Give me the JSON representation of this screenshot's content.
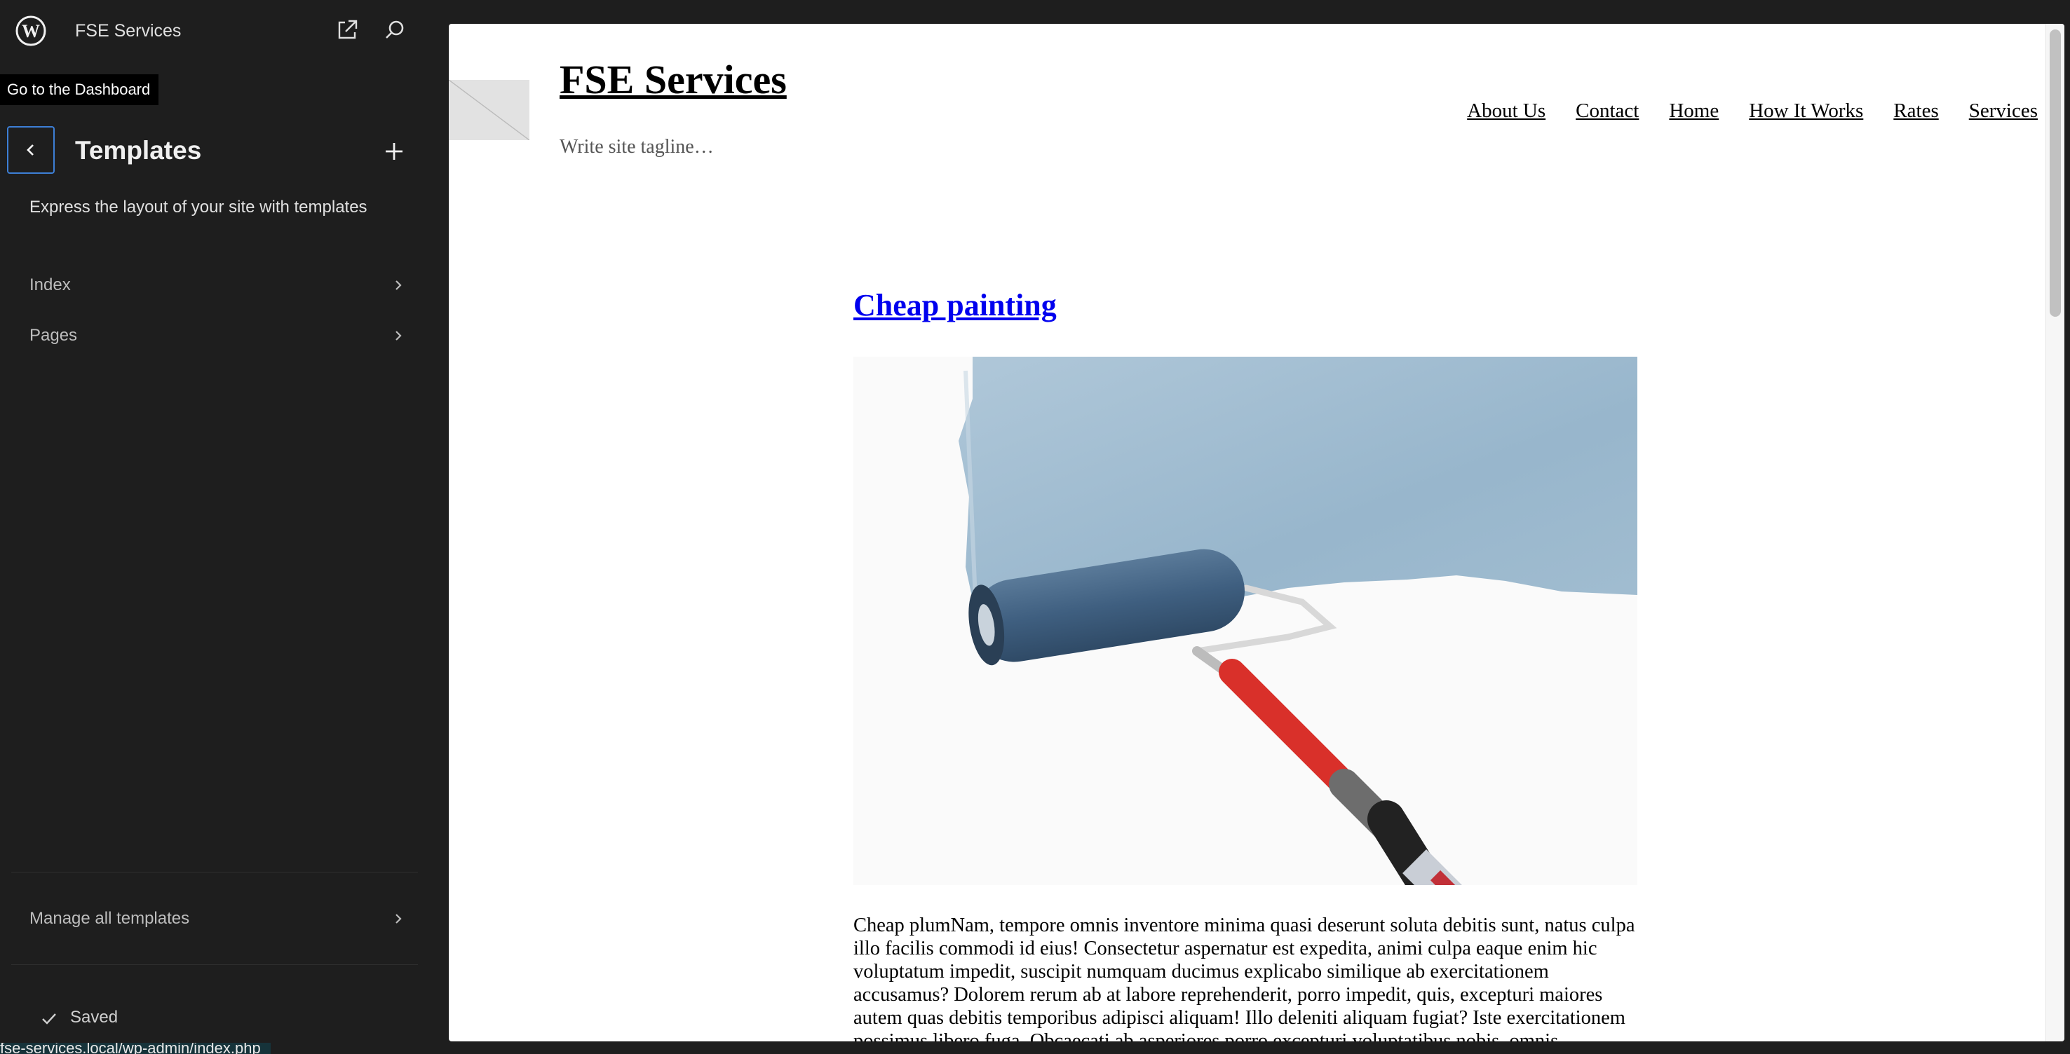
{
  "sidebar": {
    "site_name": "FSE Services",
    "tooltip": "Go to the Dashboard",
    "section_title": "Templates",
    "section_description": "Express the layout of your site with templates",
    "items": [
      {
        "label": "Index"
      },
      {
        "label": "Pages"
      }
    ],
    "manage_label": "Manage all templates",
    "save_status": "Saved",
    "status_url": "fse-services.local/wp-admin/index.php"
  },
  "preview": {
    "site_title": "FSE Services",
    "tagline": "Write site tagline…",
    "nav": [
      "About Us",
      "Contact",
      "Home",
      "How It Works",
      "Rates",
      "Services"
    ],
    "post_title": "Cheap painting",
    "post_excerpt": "Cheap plumNam, tempore omnis inventore minima quasi deserunt soluta debitis sunt, natus culpa illo facilis commodi id eius! Consectetur aspernatur est expedita, animi culpa eaque enim hic voluptatum impedit, suscipit numquam ducimus explicabo similique ab exercitationem accusamus? Dolorem rerum ab at labore reprehenderit, porro impedit, quis, excepturi maiores autem quas debitis temporibus adipisci aliquam! Illo deleniti aliquam fugiat? Iste exercitationem possimus libero fuga. Obcaecati ab asperiores porro excepturi voluptatibus nobis, omnis"
  },
  "icons": {
    "wordpress": "wordpress-logo-icon",
    "external": "external-link-icon",
    "search": "search-icon",
    "back": "chevron-left-icon",
    "add": "plus-icon",
    "chevron": "chevron-right-icon",
    "check": "check-icon"
  },
  "colors": {
    "sidebar_bg": "#1e1e1e",
    "focus_accent": "#3d7fd6",
    "post_link": "#0000ee"
  }
}
